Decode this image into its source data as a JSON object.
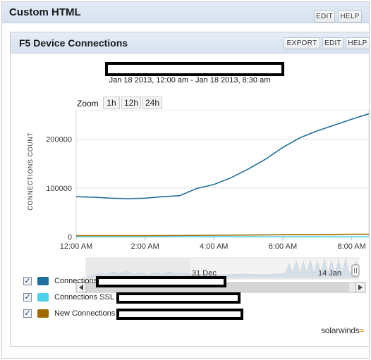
{
  "outer": {
    "title": "Custom HTML",
    "edit_label": "EDIT",
    "help_label": "HELP"
  },
  "panel": {
    "title": "F5 Device Connections",
    "export_label": "EXPORT",
    "edit_label": "EDIT",
    "help_label": "HELP"
  },
  "chart": {
    "date_range": "Jan 18 2013, 12:00 am - Jan 18 2013, 8:30 am",
    "zoom_label": "Zoom",
    "zoom_options": [
      "1h",
      "12h",
      "24h"
    ],
    "y_axis_label": "CONNECTIONS COUNT",
    "navigator_labels": [
      "31 Dec",
      "14 Jan"
    ],
    "scroll_left_icon": "arrow-left-icon",
    "scroll_right_icon": "arrow-right-icon"
  },
  "chart_data": {
    "type": "line",
    "ylabel": "CONNECTIONS COUNT",
    "ylim": [
      0,
      260000
    ],
    "yticks": [
      0,
      100000,
      200000
    ],
    "ytick_labels": [
      "0",
      "100000",
      "200000"
    ],
    "xlim": [
      0,
      8.5
    ],
    "xticks": [
      0,
      2,
      4,
      6,
      8
    ],
    "xtick_labels": [
      "12:00 AM",
      "2:00 AM",
      "4:00 AM",
      "6:00 AM",
      "8:00 AM"
    ],
    "grid": "horizontal",
    "series": [
      {
        "name": "Connections",
        "color": "#1f6f9c",
        "x": [
          0,
          0.5,
          1,
          1.5,
          2,
          2.5,
          3,
          3.5,
          4,
          4.5,
          5,
          5.5,
          6,
          6.5,
          7,
          7.5,
          8,
          8.5
        ],
        "y": [
          82000,
          81000,
          79000,
          78000,
          79000,
          82000,
          84000,
          99000,
          107000,
          121000,
          139000,
          159000,
          183000,
          203000,
          217000,
          229000,
          241000,
          252000
        ]
      },
      {
        "name": "Connections SSL",
        "color": "#4fd0ec",
        "x": [
          0,
          8.5
        ],
        "y": [
          0,
          0
        ]
      },
      {
        "name": "New Connections",
        "color": "#a06a00",
        "x": [
          0,
          1,
          2,
          3,
          4,
          5,
          6,
          7,
          8,
          8.5
        ],
        "y": [
          2000,
          2000,
          2000,
          2500,
          3000,
          3500,
          4000,
          4500,
          5000,
          5000
        ]
      }
    ]
  },
  "legend": [
    {
      "label": "Connections",
      "color": "#1f6f9c",
      "checked": "✓"
    },
    {
      "label": "Connections SSL",
      "color": "#4fd0ec",
      "checked": "✓"
    },
    {
      "label": "New Connections",
      "color": "#a06a00",
      "checked": "✓"
    }
  ],
  "brand": {
    "name": "solarwinds",
    "mark_color": "#f07a00"
  }
}
